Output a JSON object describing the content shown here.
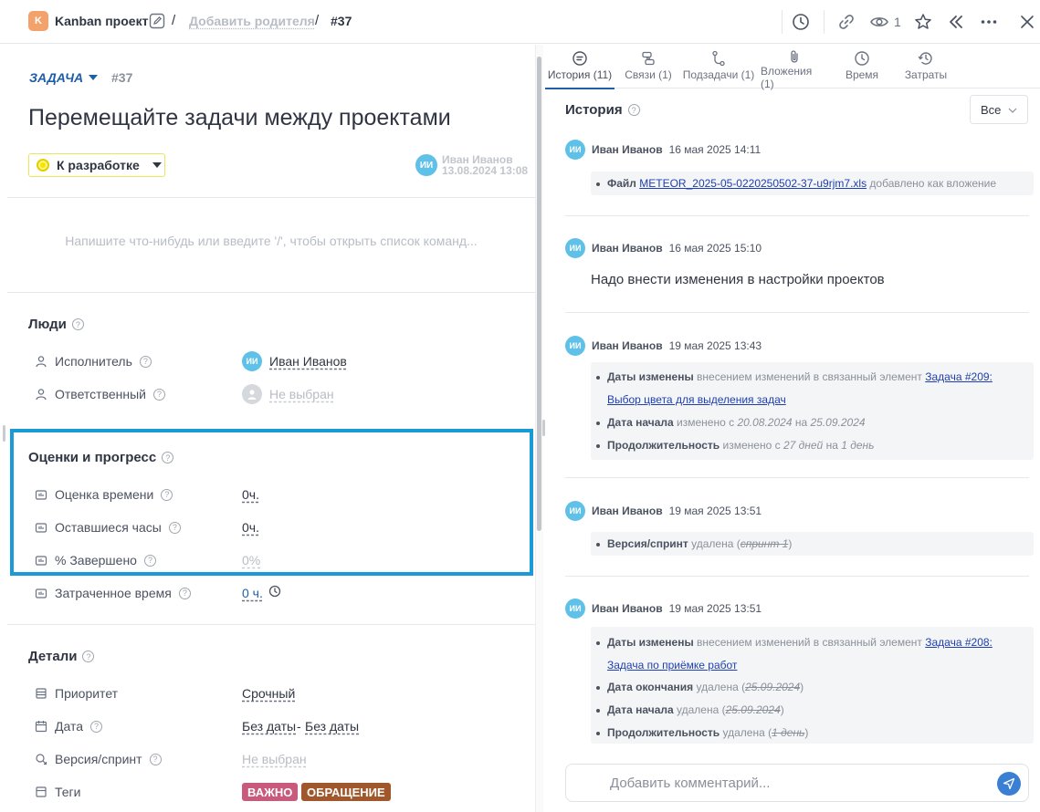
{
  "header": {
    "project_badge": "K",
    "project_name": "Kanban проект",
    "sep1": "/",
    "add_parent": "Добавить родителя",
    "sep2": "/",
    "task_ref": "#37",
    "watch_count": "1"
  },
  "task": {
    "type_label": "ЗАДАЧА",
    "id": "#37",
    "title": "Перемещайте задачи между проектами",
    "status": "К разработке",
    "author_initials": "ИИ",
    "author_name": "Иван Иванов",
    "author_date": "13.08.2024 13:08",
    "editor_placeholder": "Напишите что-нибудь или введите '/', чтобы открыть список команд..."
  },
  "people": {
    "title": "Люди",
    "assignee_label": "Исполнитель",
    "assignee_initials": "ИИ",
    "assignee_value": "Иван Иванов",
    "responsible_label": "Ответственный",
    "responsible_value": "Не выбран"
  },
  "estimates": {
    "title": "Оценки и прогресс",
    "estimate_label": "Оценка времени",
    "estimate_value": "0ч.",
    "remaining_label": "Оставшиеся часы",
    "remaining_value": "0ч.",
    "complete_label": "% Завершено",
    "complete_value": "0%",
    "spent_label": "Затраченное время",
    "spent_value": "0 ч."
  },
  "details": {
    "title": "Детали",
    "priority_label": "Приоритет",
    "priority_value": "Срочный",
    "date_label": "Дата",
    "date_start": "Без даты",
    "date_dash": "-",
    "date_end": "Без даты",
    "sprint_label": "Версия/спринт",
    "sprint_value": "Не выбран",
    "tags_label": "Теги",
    "tags": [
      {
        "label": "ВАЖНО",
        "color": "#c85a7c"
      },
      {
        "label": "ОБРАЩЕНИЕ",
        "color": "#a0572b"
      }
    ]
  },
  "tabs": [
    {
      "label": "История (11)",
      "icon": "comment-icon"
    },
    {
      "label": "Связи (1)",
      "icon": "links-icon"
    },
    {
      "label": "Подзадачи (1)",
      "icon": "subtasks-icon"
    },
    {
      "label": "Вложения (1)",
      "icon": "paperclip-icon"
    },
    {
      "label": "Время",
      "icon": "clock-icon"
    },
    {
      "label": "Затраты",
      "icon": "history-icon"
    }
  ],
  "history": {
    "title": "История",
    "filter": "Все",
    "entries": [
      {
        "initials": "ИИ",
        "author": "Иван Иванов",
        "date": "16 мая 2025 14:11",
        "items": [
          {
            "bold": "Файл",
            "link": "METEOR_2025-05-0220250502-37-u9rjm7.xls",
            "rest": "добавлено как вложение"
          }
        ]
      },
      {
        "initials": "ИИ",
        "author": "Иван Иванов",
        "date": "16 мая 2025 15:10",
        "comment": "Надо внести изменения в настройки проектов"
      },
      {
        "initials": "ИИ",
        "author": "Иван Иванов",
        "date": "19 мая 2025 13:43",
        "items": [
          {
            "bold": "Даты изменены",
            "rest": "внесением изменений в связанный элемент",
            "link": "Задача #209:",
            "link2": "Выбор цвета для выделения задач"
          },
          {
            "bold": "Дата начала",
            "rest": "изменено с",
            "from": "20.08.2024",
            "mid": "на",
            "to": "25.09.2024"
          },
          {
            "bold": "Продолжительность",
            "rest": "изменено с",
            "from": "27 дней",
            "mid": "на",
            "to": "1 день"
          }
        ]
      },
      {
        "initials": "ИИ",
        "author": "Иван Иванов",
        "date": "19 мая 2025 13:51",
        "items": [
          {
            "bold": "Версия/спринт",
            "rest": "удалена",
            "old": "спринт 1"
          }
        ]
      },
      {
        "initials": "ИИ",
        "author": "Иван Иванов",
        "date": "19 мая 2025 13:51",
        "items": [
          {
            "bold": "Даты изменены",
            "rest": "внесением изменений в связанный элемент",
            "link": "Задача #208:",
            "link2": "Задача по приёмке работ"
          },
          {
            "bold": "Дата окончания",
            "rest": "удалена",
            "old": "25.09.2024"
          },
          {
            "bold": "Дата начала",
            "rest": "удалена",
            "old": "25.09.2024"
          },
          {
            "bold": "Продолжительность",
            "rest": "удалена",
            "old": "1 день"
          }
        ]
      }
    ]
  },
  "comment": {
    "placeholder": "Добавить комментарий..."
  }
}
